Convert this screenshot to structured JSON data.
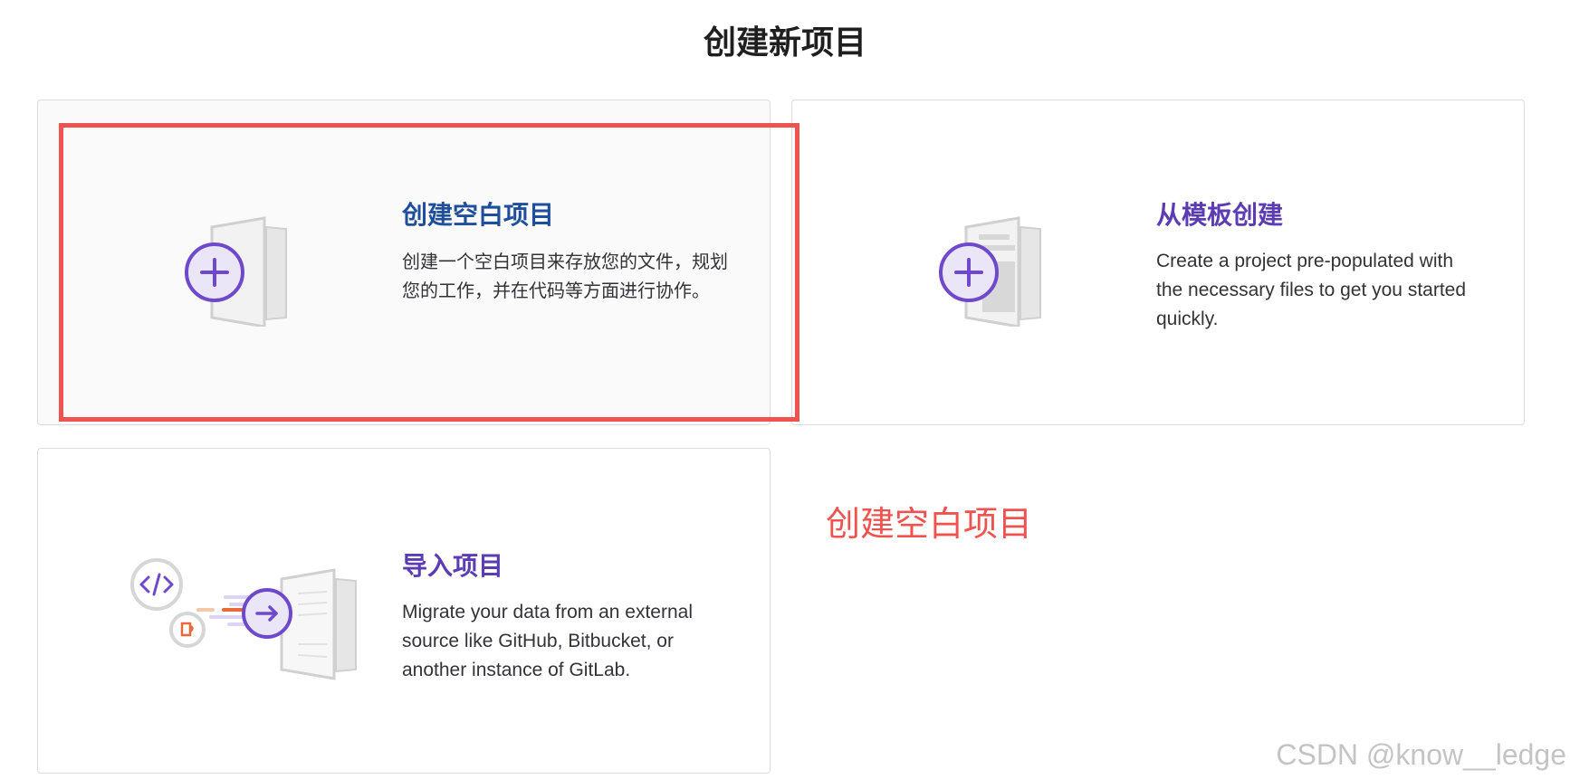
{
  "page": {
    "title": "创建新项目"
  },
  "cards": {
    "blank": {
      "title": "创建空白项目",
      "description": "创建一个空白项目来存放您的文件，规划您的工作，并在代码等方面进行协作。",
      "icon": "plus-icon"
    },
    "template": {
      "title": "从模板创建",
      "description": "Create a project pre-populated with the necessary files to get you started quickly.",
      "icon": "plus-icon"
    },
    "import": {
      "title": "导入项目",
      "description": "Migrate your data from an external source like GitHub, Bitbucket, or another instance of GitLab.",
      "icon": "arrow-right-icon"
    }
  },
  "annotation": {
    "text": "创建空白项目"
  },
  "watermark": {
    "text": "CSDN @know__ledge"
  },
  "colors": {
    "accent_purple": "#6e49cb",
    "highlight_red": "#ef5350",
    "title_blue": "#1f4f9c"
  }
}
